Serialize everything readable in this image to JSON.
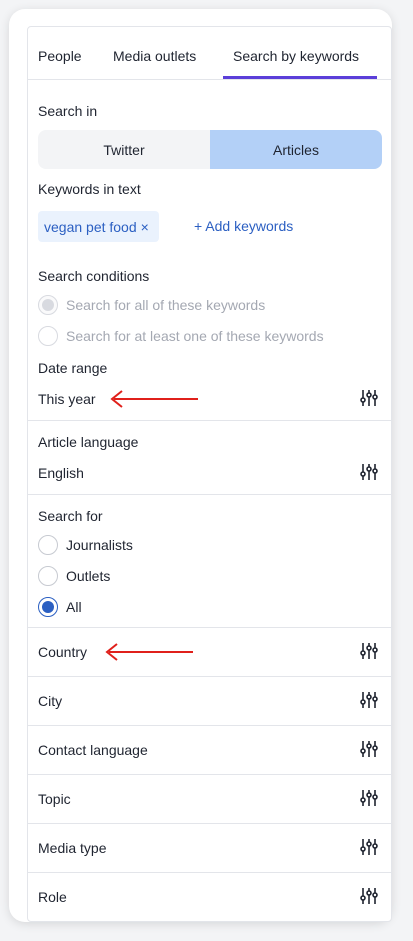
{
  "tabs": [
    {
      "label": "People",
      "active": false
    },
    {
      "label": "Media outlets",
      "active": false
    },
    {
      "label": "Search by keywords",
      "active": true
    }
  ],
  "search_in": {
    "label": "Search in",
    "options": [
      "Twitter",
      "Articles"
    ],
    "selected": "Articles"
  },
  "keywords": {
    "label": "Keywords in text",
    "chips": [
      "vegan pet food"
    ],
    "remove_icon": "×",
    "add_label": "+ Add keywords"
  },
  "conditions": {
    "label": "Search conditions",
    "options": [
      "Search for all of these keywords",
      "Search for at least one of these keywords"
    ],
    "selected": "Search for all of these keywords",
    "disabled": true
  },
  "date_range": {
    "label": "Date range",
    "value": "This year"
  },
  "article_language": {
    "label": "Article language",
    "value": "English"
  },
  "search_for": {
    "label": "Search for",
    "options": [
      "Journalists",
      "Outlets",
      "All"
    ],
    "selected": "All"
  },
  "filters": [
    "Country",
    "City",
    "Contact language",
    "Topic",
    "Media type",
    "Role"
  ],
  "icons": {
    "filter": "sliders-icon",
    "annotation": "red-arrow"
  },
  "colors": {
    "accent": "#5b3fd9",
    "link": "#2b5fc2",
    "segment_selected": "#b3d0f7",
    "annotation_arrow": "#e0201b"
  }
}
